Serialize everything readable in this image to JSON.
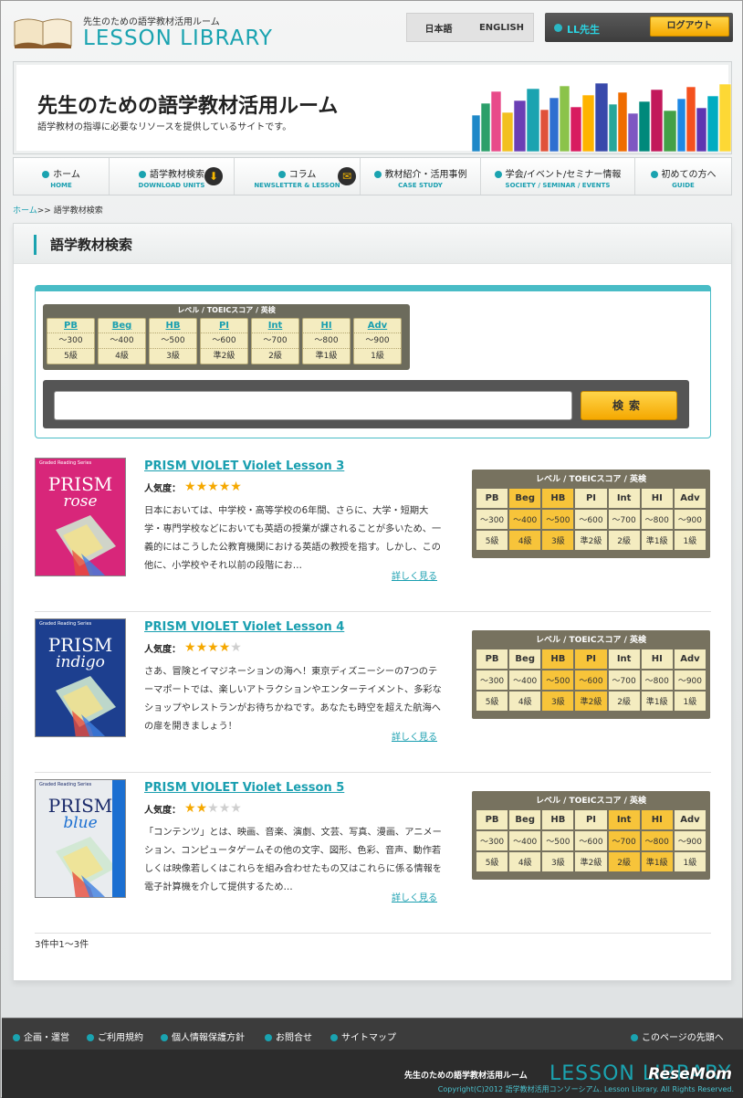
{
  "header": {
    "logo_sub": "先生のための語学教材活用ルーム",
    "logo_main": "LESSON LIBRARY",
    "lang_ja": "日本語",
    "lang_en": "ENGLISH",
    "user_name": "LL先生",
    "logout_label": "ログアウト"
  },
  "hero": {
    "title": "先生のための語学教材活用ルーム",
    "description": "語学教材の指導に必要なリソースを提供しているサイトです。"
  },
  "nav": [
    {
      "label": "ホーム",
      "sub": "HOME"
    },
    {
      "label": "語学教材検索",
      "sub": "DOWNLOAD UNITS"
    },
    {
      "label": "コラム",
      "sub": "NEWSLETTER & LESSON"
    },
    {
      "label": "教材紹介・活用事例",
      "sub": "CASE STUDY"
    },
    {
      "label": "学会/イベント/セミナー情報",
      "sub": "SOCIETY / SEMINAR / EVENTS"
    },
    {
      "label": "初めての方へ",
      "sub": "GUIDE"
    }
  ],
  "breadcrumb": {
    "home": "ホーム",
    "sep": ">> ",
    "current": "語学教材検索"
  },
  "page_title": "語学教材検索",
  "level_header": "レベル / TOEICスコア / 英検",
  "levels": [
    {
      "name": "PB",
      "score": "～300",
      "grade": "5級"
    },
    {
      "name": "Beg",
      "score": "～400",
      "grade": "4級"
    },
    {
      "name": "HB",
      "score": "～500",
      "grade": "3級"
    },
    {
      "name": "PI",
      "score": "～600",
      "grade": "準2級"
    },
    {
      "name": "Int",
      "score": "～700",
      "grade": "2級"
    },
    {
      "name": "HI",
      "score": "～800",
      "grade": "準1級"
    },
    {
      "name": "Adv",
      "score": "～900",
      "grade": "1級"
    }
  ],
  "search": {
    "value": "",
    "button": "検索"
  },
  "popularity_label": "人気度：",
  "more_label": "詳しく見る",
  "results": [
    {
      "title": "PRISM  VIOLET Violet Lesson 3",
      "stars": 5,
      "cover_series": "Graded Reading Series",
      "cover_title": "PRISM",
      "cover_sub": "rose",
      "cover_color": "#d8267a",
      "description": "日本においては、中学校・高等学校の6年間、さらに、大学・短期大学・専門学校などにおいても英語の授業が課されることが多いため、一義的にはこうした公教育機関における英語の教授を指す。しかし、この他に、小学校やそれ以前の段階にお…",
      "highlight": [
        1,
        2
      ]
    },
    {
      "title": "PRISM  VIOLET Violet Lesson 4",
      "stars": 4,
      "cover_series": "Graded Reading Series",
      "cover_title": "PRISM",
      "cover_sub": "indigo",
      "cover_color": "#1d3f8f",
      "description": "さあ、冒険とイマジネーションの海へ！東京ディズニーシーの7つのテーマポートでは、楽しいアトラクションやエンターテイメント、多彩なショップやレストランがお待ちかねです。あなたも時空を超えた航海への扉を開きましょう！",
      "highlight": [
        2,
        3
      ]
    },
    {
      "title": "PRISM  VIOLET Violet Lesson 5",
      "stars": 2,
      "cover_series": "Graded Reading Series",
      "cover_title": "PRISM",
      "cover_sub": "blue",
      "cover_color": "#e9ecef",
      "description": "「コンテンツ」とは、映画、音楽、演劇、文芸、写真、漫画、アニメーション、コンピュータゲームその他の文字、図形、色彩、音声、動作若しくは映像若しくはこれらを組み合わせたもの又はこれらに係る情報を電子計算機を介して提供するため…",
      "highlight": [
        4,
        5
      ]
    }
  ],
  "result_count": "3件中1～3件",
  "footer": {
    "links": [
      "企画・運営",
      "ご利用規約",
      "個人情報保護方針",
      "お問合せ",
      "サイトマップ"
    ],
    "to_top": "このページの先頭へ",
    "site_name": "先生のための語学教材活用ルーム",
    "logo": "LESSON LIBRARY",
    "copyright": "Copyright(C)2012 語学教材活用コンソーシアム. Lesson Library. All Rights Reserved.",
    "watermark": "ReseMom"
  }
}
